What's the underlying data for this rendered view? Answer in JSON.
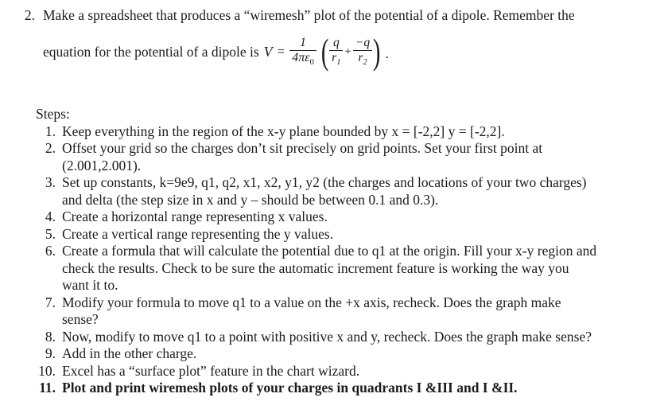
{
  "problem": {
    "number": "2.",
    "line1": "Make a spreadsheet that produces a “wiremesh” plot of the potential of a dipole.  Remember the",
    "line2_lead": "equation for the potential of a dipole is",
    "equation": {
      "variable": "V",
      "equals": "=",
      "outer_numerator": "1",
      "outer_denominator": "4πε",
      "outer_denominator_sub": "0",
      "left_paren": "(",
      "term1_numerator": "q",
      "term1_denominator": "r",
      "term1_denominator_sub": "1",
      "operator": "+",
      "term2_numerator": "−q",
      "term2_denominator": "r",
      "term2_denominator_sub": "2",
      "right_paren": ")",
      "trailing_period": "."
    }
  },
  "steps": {
    "title": "Steps:",
    "items": [
      {
        "number": "1.",
        "lines": [
          "Keep everything in the region of the x-y plane bounded by x = [-2,2]  y = [-2,2]."
        ],
        "bold": false
      },
      {
        "number": "2.",
        "lines": [
          "Offset your grid so the charges don’t sit precisely on grid points.  Set your first point at",
          "(2.001,2.001)."
        ],
        "bold": false
      },
      {
        "number": "3.",
        "lines": [
          "Set up constants, k=9e9, q1, q2, x1, x2, y1, y2 (the charges and locations of your two charges)",
          "and delta (the step size in x and y – should be between 0.1 and 0.3)."
        ],
        "bold": false
      },
      {
        "number": "4.",
        "lines": [
          "Create a horizontal range representing x values."
        ],
        "bold": false
      },
      {
        "number": "5.",
        "lines": [
          "Create a vertical range representing the y values."
        ],
        "bold": false
      },
      {
        "number": "6.",
        "lines": [
          "Create a formula that will calculate the potential due to q1 at the origin. Fill your x-y region and",
          "check the results.  Check to be sure the automatic increment feature is working the way you",
          "want it to."
        ],
        "bold": false
      },
      {
        "number": "7.",
        "lines": [
          "Modify your formula to move q1 to a value on the +x axis, recheck.  Does the graph make",
          "sense?"
        ],
        "bold": false
      },
      {
        "number": "8.",
        "lines": [
          "Now, modify to move q1 to a point with positive x and y, recheck.  Does the graph make sense?"
        ],
        "bold": false
      },
      {
        "number": "9.",
        "lines": [
          "Add in the other charge."
        ],
        "bold": false
      },
      {
        "number": "10.",
        "lines": [
          "Excel has a “surface plot” feature in the chart wizard."
        ],
        "bold": false
      },
      {
        "number": "11.",
        "lines": [
          "Plot and print wiremesh plots of your charges in quadrants I &III and I &II."
        ],
        "bold": true
      }
    ]
  }
}
